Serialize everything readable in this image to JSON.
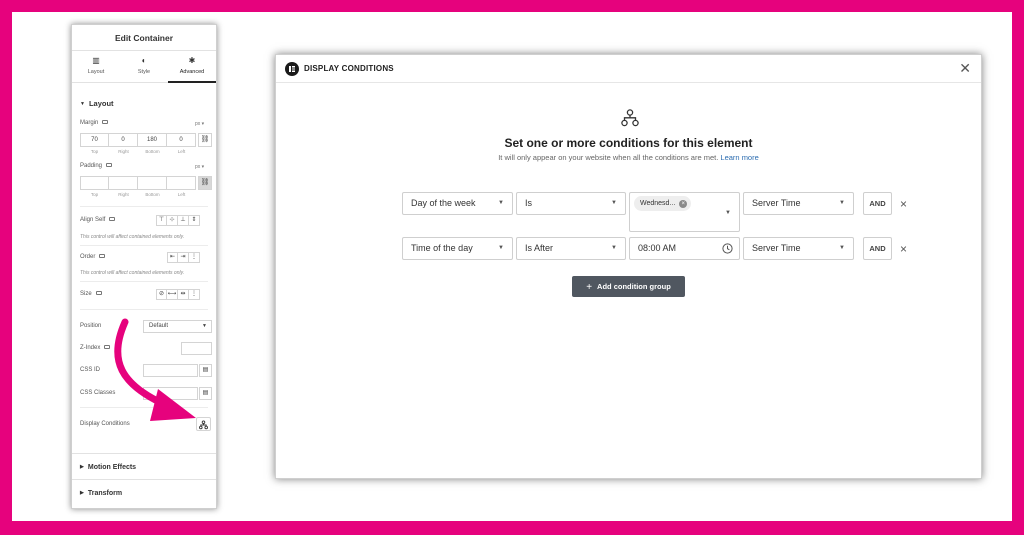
{
  "panel": {
    "title": "Edit Container",
    "tabs": [
      {
        "label": "Layout",
        "icon": "layout-icon"
      },
      {
        "label": "Style",
        "icon": "style-icon"
      },
      {
        "label": "Advanced",
        "icon": "gear-icon",
        "active": true
      }
    ],
    "layout_section": "Layout",
    "margin": {
      "label": "Margin",
      "unit": "px",
      "values": [
        "70",
        "0",
        "180",
        "0"
      ],
      "side_labels": [
        "Top",
        "Right",
        "Bottom",
        "Left"
      ]
    },
    "padding": {
      "label": "Padding",
      "unit": "px",
      "values": [
        "",
        "",
        "",
        ""
      ],
      "side_labels": [
        "Top",
        "Right",
        "Bottom",
        "Left"
      ]
    },
    "align_self": {
      "label": "Align Self",
      "note": "This control will affect contained elements only."
    },
    "order": {
      "label": "Order",
      "note": "This control will affect contained elements only."
    },
    "size": {
      "label": "Size"
    },
    "position": {
      "label": "Position",
      "value": "Default"
    },
    "z_index": {
      "label": "Z-Index",
      "value": ""
    },
    "css_id": {
      "label": "CSS ID",
      "value": ""
    },
    "css_classes": {
      "label": "CSS Classes",
      "value": ""
    },
    "display_conditions": {
      "label": "Display Conditions"
    },
    "motion_effects": "Motion Effects",
    "transform": "Transform"
  },
  "modal": {
    "title": "DISPLAY CONDITIONS",
    "heading": "Set one or more conditions for this element",
    "subtext": "It will only appear on your website when all the conditions are met.",
    "learn_more": "Learn more",
    "rows": [
      {
        "field": "Day of the week",
        "operator": "Is",
        "value": "Wednesd...",
        "value_type": "chip",
        "time_source": "Server Time",
        "and_label": "AND"
      },
      {
        "field": "Time of the day",
        "operator": "Is After",
        "value": "08:00 AM",
        "value_type": "time",
        "time_source": "Server Time",
        "and_label": "AND"
      }
    ],
    "add_group_label": "Add condition group"
  },
  "colors": {
    "frame": "#e6027d",
    "annotation_arrow": "#e6027d",
    "add_button": "#505760"
  }
}
